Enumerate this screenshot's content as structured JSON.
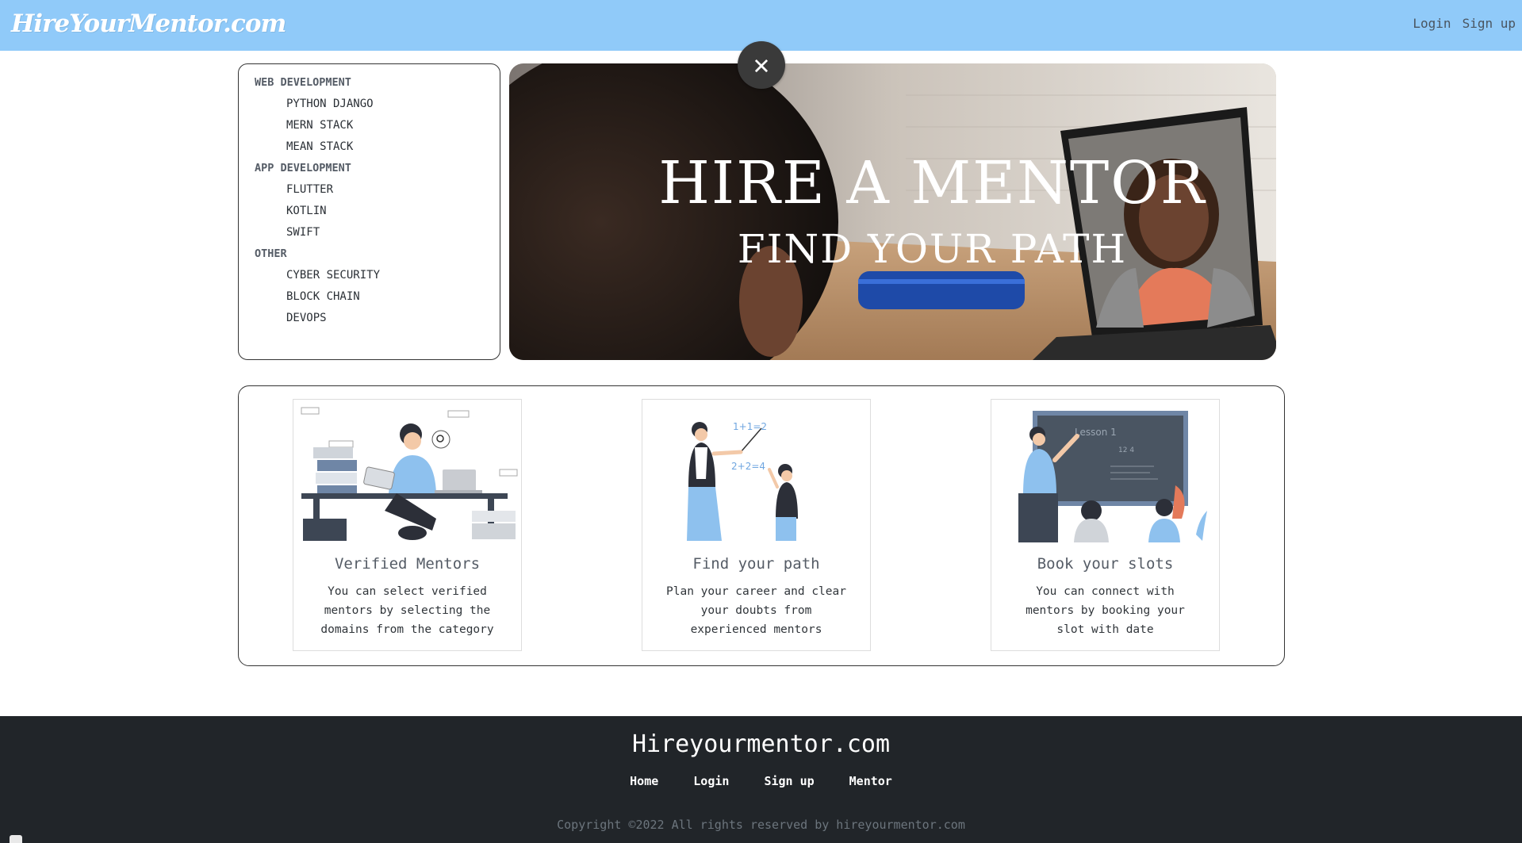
{
  "header": {
    "brand": "HireYourMentor.com",
    "login": "Login",
    "signup": "Sign up"
  },
  "sidebar": {
    "categories": [
      {
        "title": "WEB DEVELOPMENT",
        "items": [
          "PYTHON DJANGO",
          "MERN STACK",
          "MEAN STACK"
        ]
      },
      {
        "title": "APP DEVELOPMENT",
        "items": [
          "FLUTTER",
          "KOTLIN",
          "SWIFT"
        ]
      },
      {
        "title": "OTHER",
        "items": [
          "CYBER SECURITY",
          "BLOCK CHAIN",
          "DEVOPS"
        ]
      }
    ]
  },
  "banner": {
    "heading": "HIRE A MENTOR",
    "subheading": "FIND YOUR PATH",
    "close_icon": "close-icon"
  },
  "features": [
    {
      "title": "Verified Mentors",
      "text": "You can select verified mentors by selecting the domains from the category",
      "illustration": "mentor-desk-illustration"
    },
    {
      "title": "Find your path",
      "text": "Plan your career and clear your doubts from experienced mentors",
      "illustration": "teacher-student-illustration"
    },
    {
      "title": "Book your slots",
      "text": "You can connect with mentors by booking your slot with date",
      "illustration": "classroom-illustration"
    }
  ],
  "footer": {
    "title": "Hireyourmentor.com",
    "links": [
      "Home",
      "Login",
      "Sign up",
      "Mentor"
    ],
    "copyright": "Copyright ©2022 All rights reserved by hireyourmentor.com"
  },
  "colors": {
    "header_bg": "#90caf9",
    "footer_bg": "#212529",
    "accent_blue": "#8ec1ee"
  }
}
